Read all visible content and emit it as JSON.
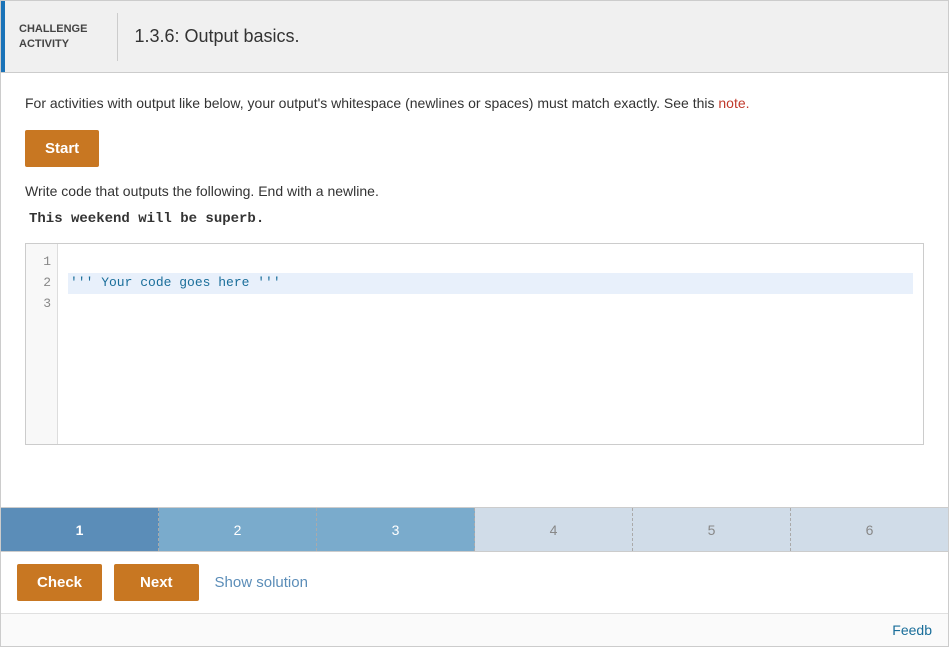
{
  "header": {
    "badge": "CHALLENGE\nACTIVITY",
    "badge_line1": "CHALLENGE",
    "badge_line2": "ACTIVITY",
    "title": "1.3.6: Output basics."
  },
  "description": {
    "text_before": "For activities with output like below, your output's whitespace (newlines or spaces) must match exactly. See this ",
    "link_text": "note.",
    "text_after": ""
  },
  "start_button": "Start",
  "task": {
    "instruction": "Write code that outputs the following. End with a newline.",
    "expected_output": "This weekend will be superb."
  },
  "code_editor": {
    "lines": [
      {
        "number": "1",
        "content": "",
        "highlighted": false
      },
      {
        "number": "2",
        "content": "''' Your code goes here '''",
        "highlighted": true
      },
      {
        "number": "3",
        "content": "",
        "highlighted": false
      }
    ]
  },
  "progress_bar": {
    "segments": [
      {
        "label": "1",
        "state": "active"
      },
      {
        "label": "2",
        "state": "semi-active"
      },
      {
        "label": "3",
        "state": "semi-active"
      },
      {
        "label": "4",
        "state": "inactive"
      },
      {
        "label": "5",
        "state": "inactive"
      },
      {
        "label": "6",
        "state": "inactive"
      }
    ]
  },
  "actions": {
    "check": "Check",
    "next": "Next",
    "show_solution": "Show solution"
  },
  "feedback": {
    "label": "Feedb..."
  }
}
